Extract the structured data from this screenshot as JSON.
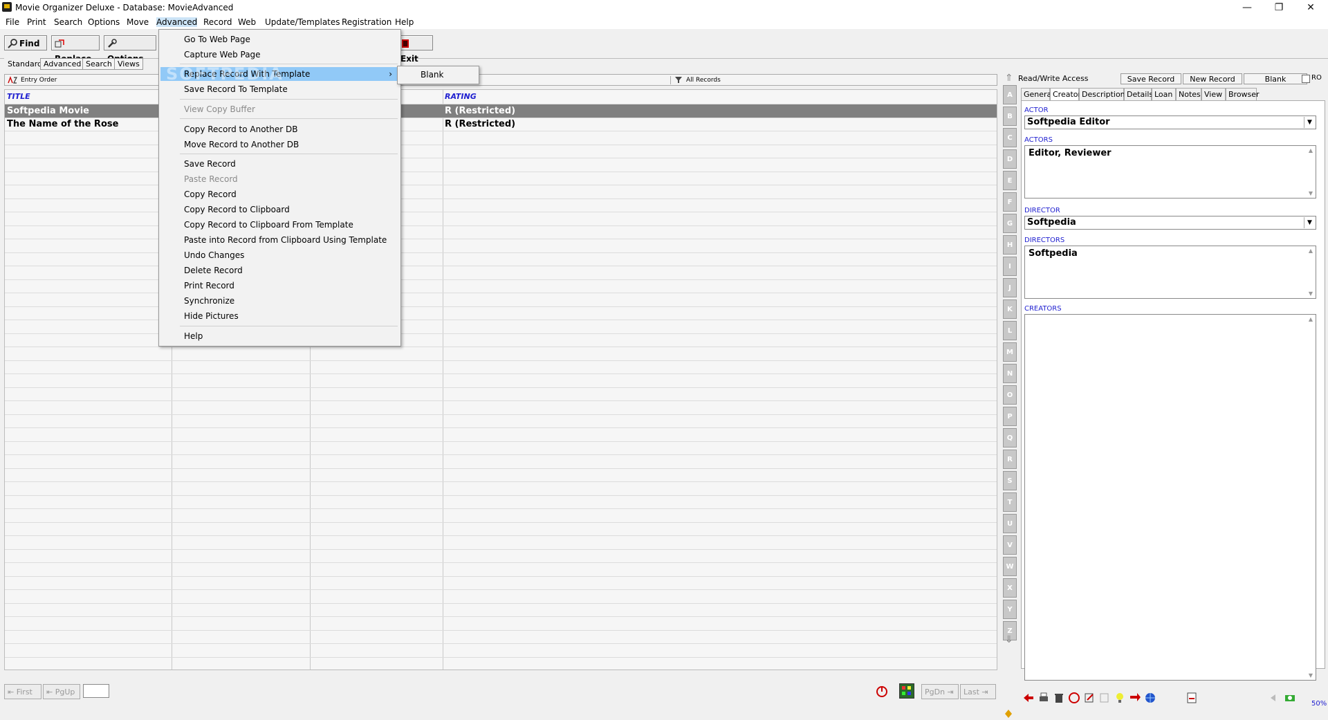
{
  "window": {
    "title": "Movie Organizer Deluxe - Database: MovieAdvanced",
    "minimize": "—",
    "maximize": "❐",
    "close": "✕"
  },
  "menubar": [
    "File",
    "Print",
    "Search",
    "Options",
    "Move",
    "Advanced",
    "Record",
    "Web",
    "Update/Templates",
    "Registration",
    "Help"
  ],
  "toolbar": {
    "find": "Find",
    "replace": "Replace",
    "options": "Options",
    "exit": "Exit"
  },
  "view_tabs": [
    "Standard",
    "Advanced",
    "Search",
    "Views"
  ],
  "list_header": {
    "order": "Entry Order",
    "filter": "All Records"
  },
  "grid": {
    "columns": [
      "TITLE",
      "RATING"
    ],
    "rows": [
      {
        "title": "Softpedia Movie",
        "rating": "R (Restricted)",
        "selected": true
      },
      {
        "title": "The Name of the Rose",
        "rating": "R (Restricted)",
        "selected": false
      }
    ]
  },
  "alphabet": [
    "A",
    "B",
    "C",
    "D",
    "E",
    "F",
    "G",
    "H",
    "I",
    "J",
    "K",
    "L",
    "M",
    "N",
    "O",
    "P",
    "Q",
    "R",
    "S",
    "T",
    "U",
    "V",
    "W",
    "X",
    "Y",
    "Z"
  ],
  "right_panel": {
    "access": "Read/Write Access",
    "save_record": "Save Record",
    "new_record": "New Record",
    "blank": "Blank",
    "ro": "RO",
    "tabs": [
      "General",
      "Creators",
      "Description",
      "Details",
      "Loan",
      "Notes",
      "View",
      "Browser"
    ],
    "active_tab": "Creators",
    "actor_label": "ACTOR",
    "actor_value": "Softpedia Editor",
    "actors_label": "ACTORS",
    "actors_value": "Editor, Reviewer",
    "director_label": "DIRECTOR",
    "director_value": "Softpedia",
    "directors_label": "DIRECTORS",
    "directors_value": "Softpedia",
    "creators_label": "CREATORS",
    "creators_value": "",
    "zoom": "50%"
  },
  "bottom_nav": {
    "first": "First",
    "pgup": "PgUp",
    "pgdn": "PgDn",
    "last": "Last",
    "record_input": ""
  },
  "advanced_menu": {
    "items": [
      {
        "label": "Go To Web Page",
        "disabled": false
      },
      {
        "label": "Capture Web Page",
        "disabled": false
      },
      {
        "label": "Replace Record With Template",
        "disabled": false,
        "highlighted": true,
        "submenu": true
      },
      {
        "label": "Save Record To Template",
        "disabled": false
      },
      {
        "label": "View Copy Buffer",
        "disabled": true
      },
      {
        "label": "Copy Record to Another DB",
        "disabled": false
      },
      {
        "label": "Move Record to Another DB",
        "disabled": false
      },
      {
        "label": "Save Record",
        "disabled": false
      },
      {
        "label": "Paste Record",
        "disabled": true
      },
      {
        "label": "Copy Record",
        "disabled": false
      },
      {
        "label": "Copy Record to Clipboard",
        "disabled": false
      },
      {
        "label": "Copy Record to Clipboard From Template",
        "disabled": false
      },
      {
        "label": "Paste into Record from Clipboard Using Template",
        "disabled": false
      },
      {
        "label": "Undo Changes",
        "disabled": false
      },
      {
        "label": "Delete Record",
        "disabled": false
      },
      {
        "label": "Print Record",
        "disabled": false
      },
      {
        "label": "Synchronize",
        "disabled": false
      },
      {
        "label": "Hide Pictures",
        "disabled": false
      },
      {
        "label": "Help",
        "disabled": false
      }
    ],
    "submenu_items": [
      "Blank"
    ]
  },
  "watermark": "SOFTPEDIA",
  "colors": {
    "selection": "#808080",
    "menu_highlight": "#91c9f7",
    "column_header": "#2020d0"
  }
}
